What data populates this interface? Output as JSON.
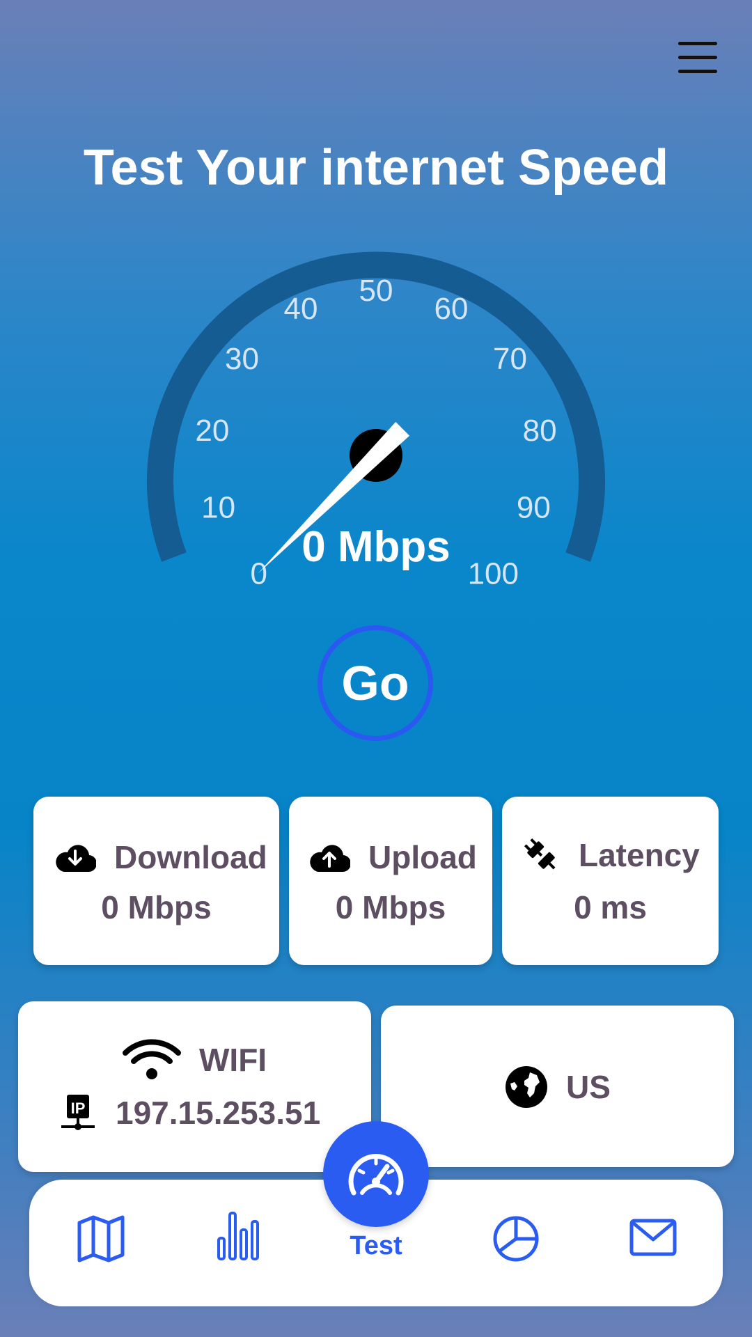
{
  "header": {
    "menu_icon": "menu-icon"
  },
  "title": "Test Your internet Speed",
  "gauge": {
    "ticks": [
      "0",
      "10",
      "20",
      "30",
      "40",
      "50",
      "60",
      "70",
      "80",
      "90",
      "100"
    ],
    "reading": "0 Mbps",
    "value": 0,
    "max": 100
  },
  "go_label": "Go",
  "stats": {
    "download": {
      "label": "Download",
      "value": "0 Mbps",
      "icon": "cloud-download-icon"
    },
    "upload": {
      "label": "Upload",
      "value": "0 Mbps",
      "icon": "cloud-upload-icon"
    },
    "latency": {
      "label": "Latency",
      "value": "0 ms",
      "icon": "plug-icon"
    }
  },
  "network": {
    "type": "WIFI",
    "ip": "197.15.253.51",
    "wifi_icon": "wifi-icon",
    "ip_icon": "ip-icon"
  },
  "location": {
    "country": "US",
    "icon": "globe-icon"
  },
  "nav": {
    "items": [
      "map-icon",
      "bar-chart-icon",
      "speedometer-icon",
      "pie-chart-icon",
      "mail-icon"
    ],
    "active_label": "Test"
  },
  "colors": {
    "accent": "#2a5cf2",
    "text": "#5d4e62",
    "gauge_track": "#155c93"
  }
}
